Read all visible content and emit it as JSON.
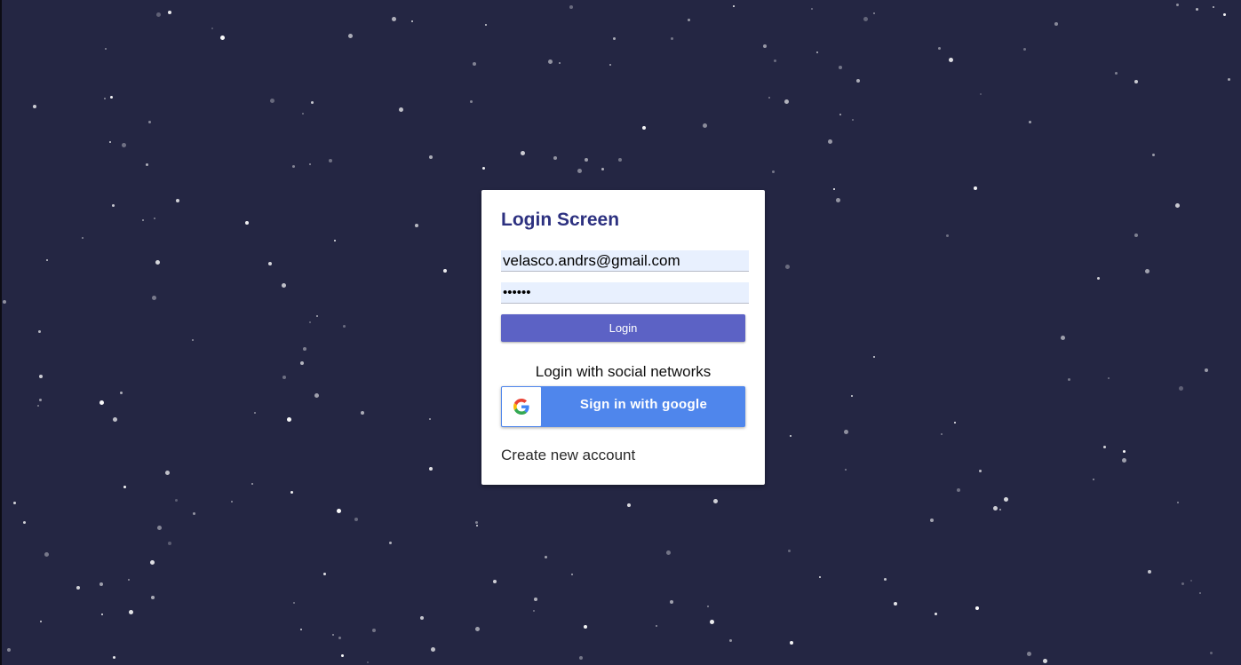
{
  "login": {
    "title": "Login Screen",
    "email_value": "velasco.andrs@gmail.com",
    "password_value": "••••••",
    "login_button_label": "Login",
    "social_label": "Login with social networks",
    "google_button_label": "Sign in with google",
    "create_account_label": "Create new account"
  },
  "colors": {
    "background": "#242643",
    "title": "#2d3180",
    "login_button": "#5c62c5",
    "google_button": "#4f86ec"
  },
  "icons": {
    "google": "google-g-icon"
  }
}
